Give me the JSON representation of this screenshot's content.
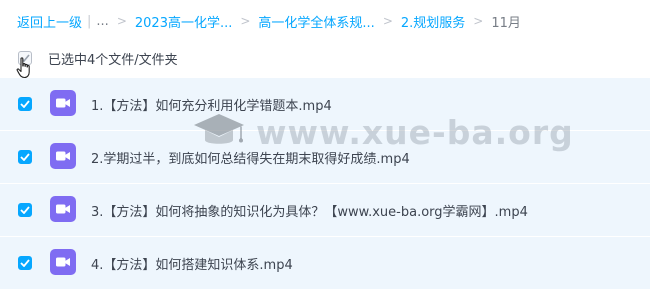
{
  "breadcrumb": {
    "back": "返回上一级",
    "ellipsis": "...",
    "items": [
      "2023高一化学...",
      "高一化学全体系规...",
      "2.规划服务"
    ],
    "current": "11月"
  },
  "selection": {
    "label": "已选中4个文件/文件夹"
  },
  "files": [
    {
      "name": "1.【方法】如何充分利用化学错题本.mp4",
      "checked": true,
      "icon": "video-file-icon"
    },
    {
      "name": "2.学期过半，到底如何总结得失在期末取得好成绩.mp4",
      "checked": true,
      "icon": "video-file-icon"
    },
    {
      "name": "3.【方法】如何将抽象的知识化为具体？【www.xue-ba.org学霸网】.mp4",
      "checked": true,
      "icon": "video-file-icon"
    },
    {
      "name": "4.【方法】如何搭建知识体系.mp4",
      "checked": true,
      "icon": "video-file-icon"
    }
  ],
  "watermark": {
    "text": "www.xue-ba.org",
    "icon": "graduation-cap-icon"
  },
  "colors": {
    "accent": "#06a7ff",
    "video_icon": "#7f6cf2",
    "row_background": "#eef6fd"
  }
}
